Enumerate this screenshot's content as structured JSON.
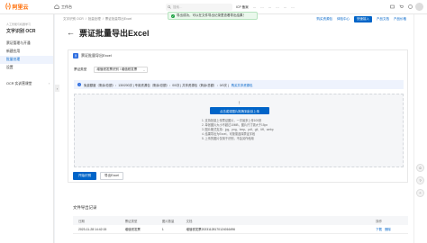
{
  "topbar": {
    "logo_mark": "(-)",
    "logo_text": "阿里云",
    "workbench": "工作台",
    "search_placeholder": "搜索…",
    "links": [
      "ICP 备案",
      "…",
      "…",
      "…",
      "…",
      "…",
      "…"
    ]
  },
  "toast": {
    "message": "导出成功，可以在文件导出记录里查看导出结果！"
  },
  "sidebar": {
    "subtitle": "人工智能与机器学习",
    "title": "文字识别 OCR",
    "items": [
      {
        "label": "票证管理与开通"
      },
      {
        "label": "新建应用"
      },
      {
        "label": "批量处理"
      },
      {
        "label": "设置"
      }
    ],
    "section": "OCR 实训营课堂"
  },
  "breadcrumb": [
    "文字识别 OCR",
    "/",
    "批量处理",
    "/",
    "票证批量导出Excel"
  ],
  "page": {
    "title": "票证批量导出Excel",
    "actions": [
      "购买资源包",
      "体验中心",
      "快速接入",
      "产品文档",
      "产品价格"
    ]
  },
  "card": {
    "badge": "票",
    "title": "票证批量导出Excel",
    "type_label": "票证类型",
    "type_value": "增值税发票识别 / 增值税发票",
    "info_text": "免费额度（剩余/总额）：130/200次 | 专用资源包（剩余/总额）：0/0次 | 共享资源包（剩余/总额）：0/0次 |",
    "info_link": "购买共享资源包",
    "upload_icon": "↑",
    "upload_button": "点击或将图片拖拽到此处上传",
    "tips": [
      "1. 支持批量上传票证图片，一次最多上传100张",
      "2. 单张图片大小不超过10MB，图片尺寸需大于15px",
      "3. 图片格式支持：jpg、png、bmp、pdf、gif、tiff、webp",
      "4. 结果导出为Excel，可按需选择票证字段",
      "5. 上传的图片仅用于识别，不会另作他用"
    ],
    "start_button": "开始识别",
    "export_button": "导出Excel"
  },
  "records": {
    "title": "文件导出记录",
    "columns": [
      "日期",
      "票证类型",
      "图片数量",
      "文档",
      "操作"
    ],
    "rows": [
      {
        "date": "2023-11-28 14:42:15",
        "type": "增值税发票",
        "count": "1",
        "doc": "增值税发票20231128170124016496",
        "actions": [
          "下载",
          "删除"
        ]
      }
    ]
  },
  "colors": {
    "primary": "#0064c8",
    "brand": "#ff6a00",
    "success": "#22a447"
  }
}
